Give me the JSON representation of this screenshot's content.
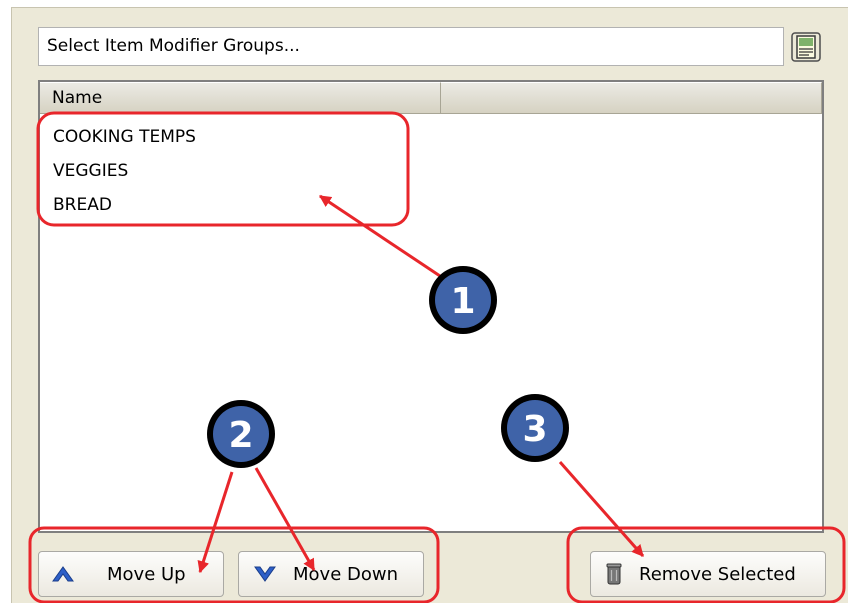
{
  "selector": {
    "label": "Select Item Modifier Groups..."
  },
  "icons": {
    "selector_icon": "form-edit-icon",
    "move_up_icon": "chevron-up-icon",
    "move_down_icon": "chevron-down-icon",
    "remove_icon": "trash-can-icon"
  },
  "list": {
    "columns": [
      "Name",
      ""
    ],
    "rows": [
      "COOKING TEMPS",
      "VEGGIES",
      "BREAD"
    ]
  },
  "buttons": {
    "move_up": "Move Up",
    "move_down": "Move Down",
    "remove_selected": "Remove Selected"
  },
  "callouts": [
    "1",
    "2",
    "3"
  ],
  "colors": {
    "annotation_red": "#e8262b",
    "badge_blue": "#3f63a8",
    "chevron_blue": "#2d5fc8"
  }
}
